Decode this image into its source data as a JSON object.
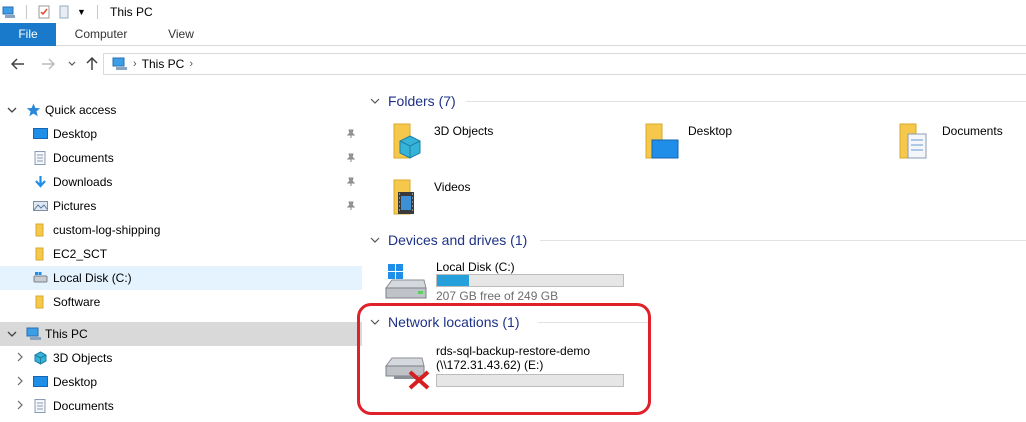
{
  "window": {
    "title": "This PC"
  },
  "ribbon": {
    "tabs": [
      "File",
      "Computer",
      "View"
    ]
  },
  "address": {
    "crumbs": [
      "This PC"
    ]
  },
  "navpane": {
    "quick_access": "Quick access",
    "items": [
      {
        "label": "Desktop",
        "icon": "desktop-icon",
        "pinned": true
      },
      {
        "label": "Documents",
        "icon": "documents-icon",
        "pinned": true
      },
      {
        "label": "Downloads",
        "icon": "downloads-icon",
        "pinned": true
      },
      {
        "label": "Pictures",
        "icon": "pictures-icon",
        "pinned": true
      },
      {
        "label": "custom-log-shipping",
        "icon": "folder-icon",
        "pinned": false
      },
      {
        "label": "EC2_SCT",
        "icon": "folder-icon",
        "pinned": false
      },
      {
        "label": "Local Disk (C:)",
        "icon": "drive-icon",
        "pinned": false,
        "selected": true
      },
      {
        "label": "Software",
        "icon": "folder-icon",
        "pinned": false
      }
    ],
    "this_pc": "This PC",
    "this_pc_children": [
      {
        "label": "3D Objects",
        "icon": "3d-objects-icon"
      },
      {
        "label": "Desktop",
        "icon": "desktop-icon"
      },
      {
        "label": "Documents",
        "icon": "documents-icon"
      }
    ]
  },
  "content": {
    "folders_header": "Folders (7)",
    "folders": [
      "3D Objects",
      "Desktop",
      "Documents",
      "Videos"
    ],
    "devices_header": "Devices and drives (1)",
    "drive": {
      "name": "Local Disk (C:)",
      "free_text": "207 GB free of 249 GB",
      "used_fraction": 0.17
    },
    "network_header": "Network locations (1)",
    "network": {
      "name": "rds-sql-backup-restore-demo",
      "path": "(\\\\172.31.43.62) (E:)",
      "used_fraction": 0
    }
  },
  "colors": {
    "accent": "#1979ca",
    "group_header": "#1e3287",
    "drive_fill": "#26a0da",
    "highlight": "#e0202a"
  }
}
